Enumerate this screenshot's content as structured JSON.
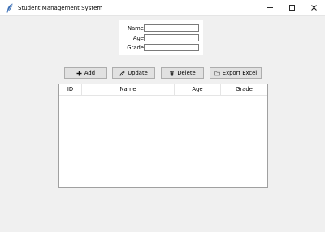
{
  "window": {
    "title": "Student Management System",
    "icon": "feather-icon",
    "controls": {
      "minimize": "–",
      "maximize": "☐",
      "close": "✕"
    }
  },
  "form": {
    "name_label": "Name",
    "age_label": "Age",
    "grade_label": "Grade",
    "name_value": "",
    "age_value": "",
    "grade_value": ""
  },
  "toolbar": {
    "add_label": "Add",
    "update_label": "Update",
    "delete_label": "Delete",
    "export_label": "Export Excel",
    "icons": {
      "add": "plus-icon",
      "update": "pencil-icon",
      "delete": "trash-icon",
      "export": "folder-icon"
    }
  },
  "table": {
    "columns": [
      "ID",
      "Name",
      "Age",
      "Grade"
    ],
    "rows": []
  },
  "colors": {
    "window_bg": "#f0f0f0",
    "button_bg": "#e1e1e1",
    "button_border": "#adadad"
  }
}
